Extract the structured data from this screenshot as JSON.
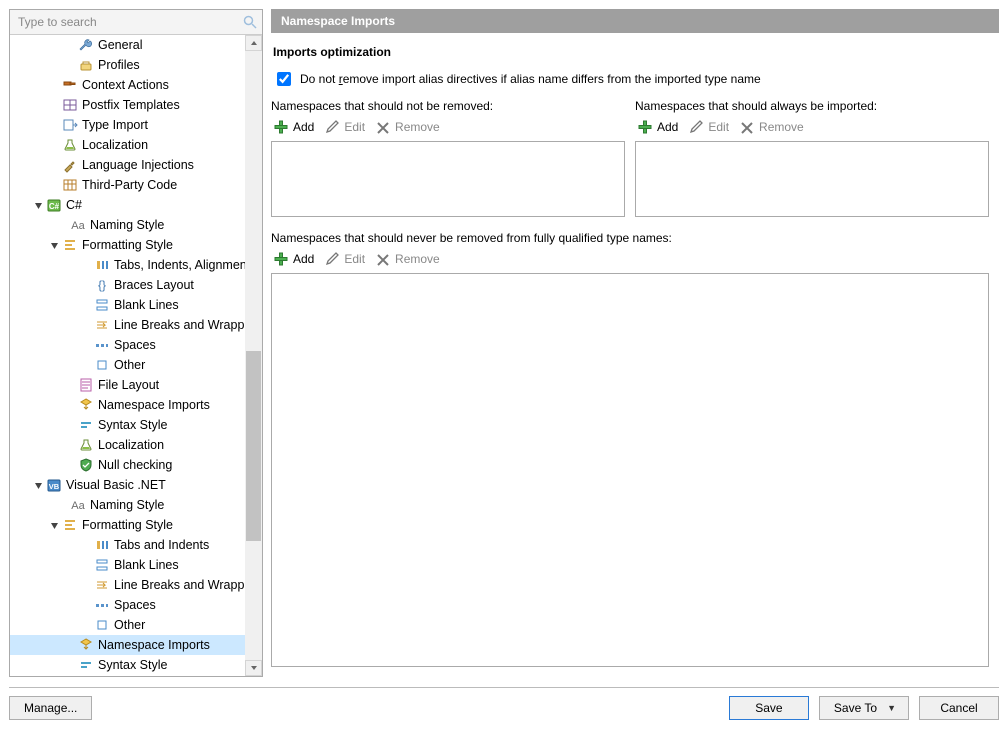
{
  "search": {
    "placeholder": "Type to search"
  },
  "header": {
    "title": "Namespace Imports"
  },
  "section": {
    "title": "Imports optimization",
    "check_pre": "Do not ",
    "check_underline": "r",
    "check_post": "emove import alias directives if alias name differs from the imported type name",
    "check_checked": true
  },
  "cols": {
    "left_label": "Namespaces that should not be removed:",
    "right_label": "Namespaces that should always be imported:",
    "full_label": "Namespaces that should never be removed from fully qualified type names:"
  },
  "toolbar": {
    "add": "Add",
    "edit": "Edit",
    "remove": "Remove"
  },
  "footer": {
    "manage": "Manage...",
    "save": "Save",
    "save_to": "Save To",
    "cancel": "Cancel"
  },
  "tree": [
    {
      "indent": 48,
      "twist": "",
      "icon": "wrench",
      "label": "General"
    },
    {
      "indent": 48,
      "twist": "",
      "icon": "profiles",
      "label": "Profiles"
    },
    {
      "indent": 32,
      "twist": "",
      "icon": "hammer",
      "label": "Context Actions"
    },
    {
      "indent": 32,
      "twist": "",
      "icon": "square-grid",
      "label": "Postfix Templates"
    },
    {
      "indent": 32,
      "twist": "",
      "icon": "type-import",
      "label": "Type Import"
    },
    {
      "indent": 32,
      "twist": "",
      "icon": "flask",
      "label": "Localization"
    },
    {
      "indent": 32,
      "twist": "",
      "icon": "inject",
      "label": "Language Injections"
    },
    {
      "indent": 32,
      "twist": "",
      "icon": "grid3",
      "label": "Third-Party Code"
    },
    {
      "indent": 16,
      "twist": "expanded",
      "icon": "csharp",
      "label": "C#"
    },
    {
      "indent": 40,
      "twist": "",
      "icon": "Aa",
      "label": "Naming Style"
    },
    {
      "indent": 32,
      "twist": "expanded",
      "icon": "format",
      "label": "Formatting Style"
    },
    {
      "indent": 64,
      "twist": "",
      "icon": "tabs",
      "label": "Tabs, Indents, Alignment"
    },
    {
      "indent": 64,
      "twist": "",
      "icon": "braces",
      "label": "Braces Layout"
    },
    {
      "indent": 64,
      "twist": "",
      "icon": "blank",
      "label": "Blank Lines"
    },
    {
      "indent": 64,
      "twist": "",
      "icon": "wrap",
      "label": "Line Breaks and Wrapping"
    },
    {
      "indent": 64,
      "twist": "",
      "icon": "spaces",
      "label": "Spaces"
    },
    {
      "indent": 64,
      "twist": "",
      "icon": "other",
      "label": "Other"
    },
    {
      "indent": 48,
      "twist": "",
      "icon": "file",
      "label": "File Layout"
    },
    {
      "indent": 48,
      "twist": "",
      "icon": "ns-import",
      "label": "Namespace Imports"
    },
    {
      "indent": 48,
      "twist": "",
      "icon": "syntax",
      "label": "Syntax Style"
    },
    {
      "indent": 48,
      "twist": "",
      "icon": "flask",
      "label": "Localization"
    },
    {
      "indent": 48,
      "twist": "",
      "icon": "shield",
      "label": "Null checking"
    },
    {
      "indent": 16,
      "twist": "expanded",
      "icon": "vb",
      "label": "Visual Basic .NET"
    },
    {
      "indent": 40,
      "twist": "",
      "icon": "Aa",
      "label": "Naming Style"
    },
    {
      "indent": 32,
      "twist": "expanded",
      "icon": "format",
      "label": "Formatting Style"
    },
    {
      "indent": 64,
      "twist": "",
      "icon": "tabs",
      "label": "Tabs and Indents"
    },
    {
      "indent": 64,
      "twist": "",
      "icon": "blank",
      "label": "Blank Lines"
    },
    {
      "indent": 64,
      "twist": "",
      "icon": "wrap",
      "label": "Line Breaks and Wrapping"
    },
    {
      "indent": 64,
      "twist": "",
      "icon": "spaces",
      "label": "Spaces"
    },
    {
      "indent": 64,
      "twist": "",
      "icon": "other",
      "label": "Other"
    },
    {
      "indent": 48,
      "twist": "",
      "icon": "ns-import",
      "label": "Namespace Imports",
      "selected": true
    },
    {
      "indent": 48,
      "twist": "",
      "icon": "syntax",
      "label": "Syntax Style"
    }
  ]
}
